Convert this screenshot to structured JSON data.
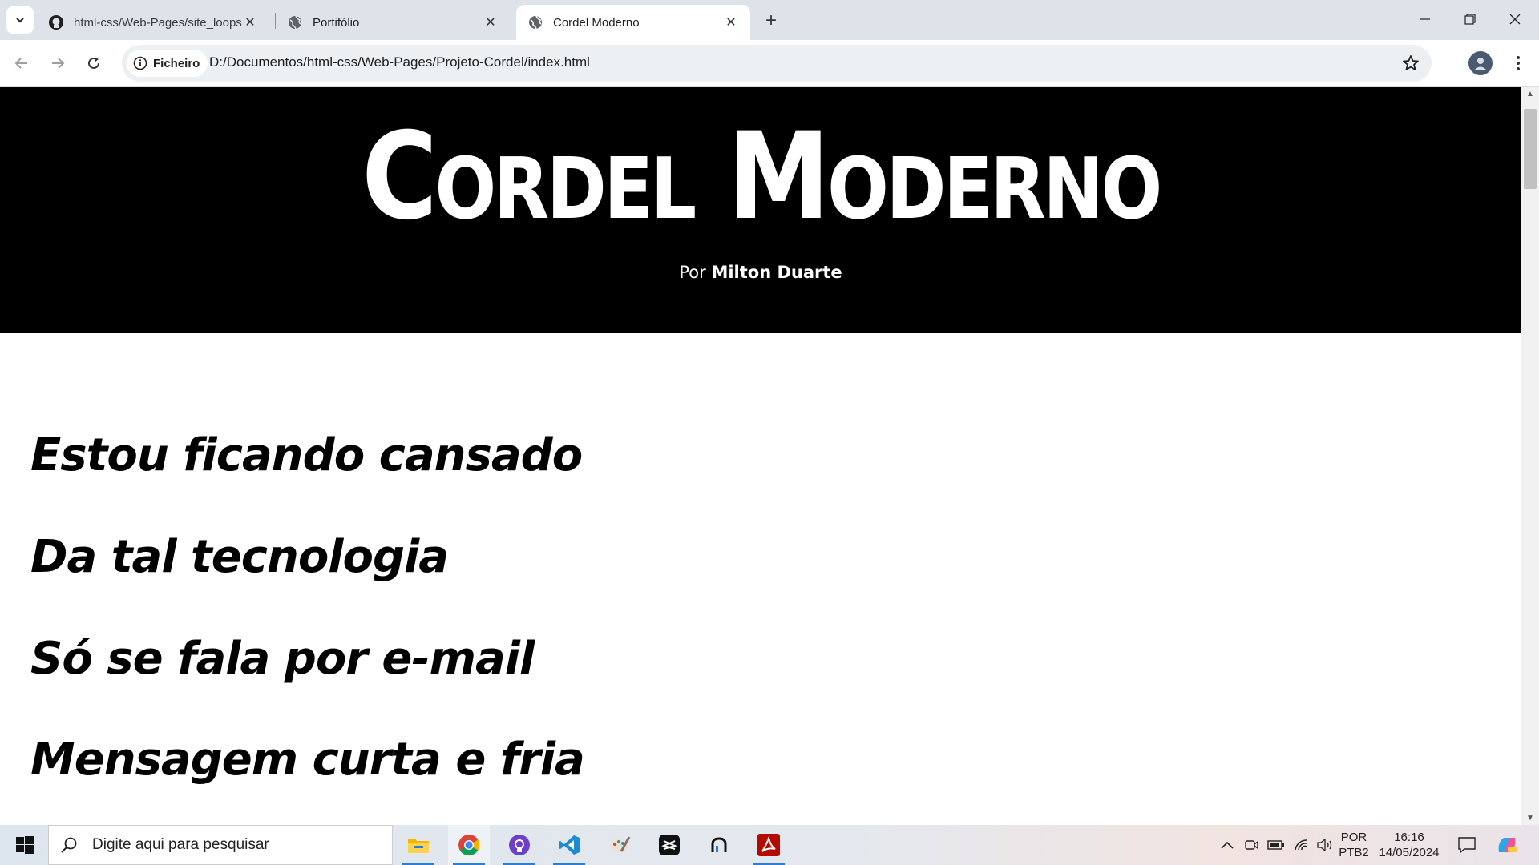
{
  "browser": {
    "tabs": [
      {
        "title": "html-css/Web-Pages/site_loops",
        "icon": "github-icon",
        "active": false
      },
      {
        "title": "Portifólio",
        "icon": "globe-icon",
        "active": false
      },
      {
        "title": "Cordel Moderno",
        "icon": "globe-icon",
        "active": true
      }
    ],
    "address": {
      "chip_label": "Ficheiro",
      "url": "D:/Documentos/html-css/Web-Pages/Projeto-Cordel/index.html"
    }
  },
  "page": {
    "title": "Cordel Moderno",
    "byline_prefix": "Por",
    "author": "Milton Duarte",
    "verses": [
      "Estou ficando cansado",
      "Da tal tecnologia",
      "Só se fala por e-mail",
      "Mensagem curta e fria"
    ],
    "colors": {
      "header_bg": "#000000",
      "header_text": "#ffffff",
      "body_bg": "#ffffff"
    }
  },
  "taskbar": {
    "search_placeholder": "Digite aqui para pesquisar",
    "apps": [
      "file-explorer-icon",
      "chrome-icon",
      "github-desktop-icon",
      "vscode-icon",
      "paint-icon",
      "capcut-icon",
      "app-icon",
      "acrobat-icon"
    ],
    "language": [
      "POR",
      "PTB2"
    ],
    "time": "16:16",
    "date": "14/05/2024"
  }
}
